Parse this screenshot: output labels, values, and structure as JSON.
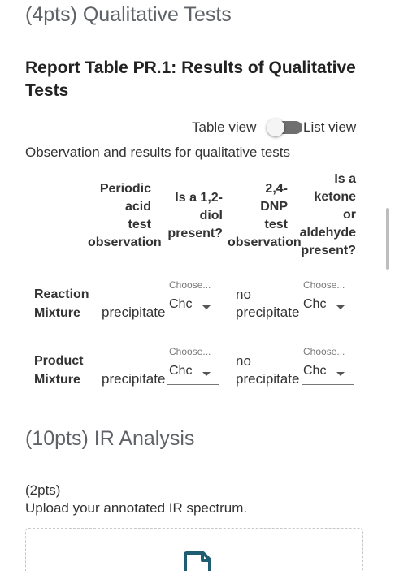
{
  "sections": {
    "qualitative_title": "(4pts) Qualitative Tests",
    "ir_title": "(10pts) IR Analysis"
  },
  "report": {
    "title": "Report Table PR.1: Results of Qualitative Tests"
  },
  "view_toggle": {
    "left_label": "Table view",
    "right_label": "List view"
  },
  "table": {
    "caption": "Observation and results for qualitative tests",
    "headers": {
      "col1": [
        "Periodic",
        "acid",
        "test",
        "observation"
      ],
      "col2": [
        "Is a 1,2-",
        "diol",
        "present?"
      ],
      "col3": [
        "2,4-",
        "DNP",
        "test",
        "observation"
      ],
      "col4": [
        "Is a",
        "ketone",
        "or",
        "aldehyde",
        "present?"
      ]
    },
    "rows": [
      {
        "label": [
          "Reaction",
          "Mixture"
        ],
        "observation1": "precipitate",
        "select1": {
          "label": "Choose...",
          "value": "Chc"
        },
        "observation2": [
          "no",
          "precipitate"
        ],
        "select2": {
          "label": "Choose...",
          "value": "Chc"
        }
      },
      {
        "label": [
          "Product",
          "Mixture"
        ],
        "observation1": "precipitate",
        "select1": {
          "label": "Choose...",
          "value": "Chc"
        },
        "observation2": [
          "no",
          "precipitate"
        ],
        "select2": {
          "label": "Choose...",
          "value": "Chc"
        }
      }
    ]
  },
  "ir": {
    "points": "(2pts)",
    "instruction": "Upload your annotated IR spectrum."
  }
}
